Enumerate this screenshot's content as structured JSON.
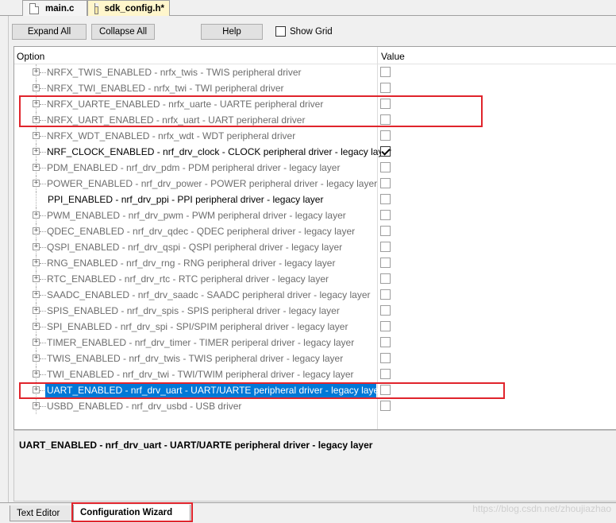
{
  "file_tabs": [
    {
      "label": "main.c",
      "active": false
    },
    {
      "label": "sdk_config.h*",
      "active": true
    }
  ],
  "toolbar": {
    "expand_all": "Expand All",
    "collapse_all": "Collapse All",
    "help": "Help",
    "show_grid": "Show Grid",
    "show_grid_checked": false
  },
  "grid": {
    "col_option": "Option",
    "col_value": "Value",
    "rows": [
      {
        "label": "NRFX_TWIS_ENABLED - nrfx_twis - TWIS peripheral driver",
        "checked": false,
        "enabled": false,
        "expandable": true
      },
      {
        "label": "NRFX_TWI_ENABLED - nrfx_twi - TWI peripheral driver",
        "checked": false,
        "enabled": false,
        "expandable": true
      },
      {
        "label": "NRFX_UARTE_ENABLED - nrfx_uarte - UARTE peripheral driver",
        "checked": false,
        "enabled": false,
        "expandable": true
      },
      {
        "label": "NRFX_UART_ENABLED - nrfx_uart - UART peripheral driver",
        "checked": false,
        "enabled": false,
        "expandable": true
      },
      {
        "label": "NRFX_WDT_ENABLED - nrfx_wdt - WDT peripheral driver",
        "checked": false,
        "enabled": false,
        "expandable": true
      },
      {
        "label": "NRF_CLOCK_ENABLED - nrf_drv_clock - CLOCK peripheral driver - legacy layer",
        "checked": true,
        "enabled": true,
        "expandable": true
      },
      {
        "label": "PDM_ENABLED - nrf_drv_pdm - PDM peripheral driver - legacy layer",
        "checked": false,
        "enabled": false,
        "expandable": true
      },
      {
        "label": "POWER_ENABLED - nrf_drv_power - POWER peripheral driver - legacy layer",
        "checked": false,
        "enabled": false,
        "expandable": true
      },
      {
        "label": "PPI_ENABLED  - nrf_drv_ppi - PPI peripheral driver - legacy layer",
        "checked": false,
        "enabled": true,
        "expandable": false
      },
      {
        "label": "PWM_ENABLED - nrf_drv_pwm - PWM peripheral driver - legacy layer",
        "checked": false,
        "enabled": false,
        "expandable": true
      },
      {
        "label": "QDEC_ENABLED - nrf_drv_qdec - QDEC peripheral driver - legacy layer",
        "checked": false,
        "enabled": false,
        "expandable": true
      },
      {
        "label": "QSPI_ENABLED - nrf_drv_qspi - QSPI peripheral driver - legacy layer",
        "checked": false,
        "enabled": false,
        "expandable": true
      },
      {
        "label": "RNG_ENABLED - nrf_drv_rng - RNG peripheral driver - legacy layer",
        "checked": false,
        "enabled": false,
        "expandable": true
      },
      {
        "label": "RTC_ENABLED - nrf_drv_rtc - RTC peripheral driver - legacy layer",
        "checked": false,
        "enabled": false,
        "expandable": true
      },
      {
        "label": "SAADC_ENABLED - nrf_drv_saadc - SAADC peripheral driver - legacy layer",
        "checked": false,
        "enabled": false,
        "expandable": true
      },
      {
        "label": "SPIS_ENABLED - nrf_drv_spis - SPIS peripheral driver - legacy layer",
        "checked": false,
        "enabled": false,
        "expandable": true
      },
      {
        "label": "SPI_ENABLED - nrf_drv_spi - SPI/SPIM peripheral driver - legacy layer",
        "checked": false,
        "enabled": false,
        "expandable": true
      },
      {
        "label": "TIMER_ENABLED - nrf_drv_timer - TIMER periperal driver - legacy layer",
        "checked": false,
        "enabled": false,
        "expandable": true
      },
      {
        "label": "TWIS_ENABLED - nrf_drv_twis - TWIS peripheral driver - legacy layer",
        "checked": false,
        "enabled": false,
        "expandable": true
      },
      {
        "label": "TWI_ENABLED - nrf_drv_twi - TWI/TWIM peripheral driver - legacy layer",
        "checked": false,
        "enabled": false,
        "expandable": true
      },
      {
        "label": "UART_ENABLED - nrf_drv_uart - UART/UARTE peripheral driver - legacy layer",
        "checked": false,
        "enabled": false,
        "expandable": true,
        "selected": true
      },
      {
        "label": "USBD_ENABLED - nrf_drv_usbd - USB driver",
        "checked": false,
        "enabled": false,
        "expandable": true
      }
    ]
  },
  "description": "UART_ENABLED - nrf_drv_uart - UART/UARTE peripheral driver - legacy layer",
  "bottom_tabs": [
    {
      "label": "Text Editor",
      "active": false
    },
    {
      "label": "Configuration Wizard",
      "active": true
    }
  ],
  "watermark": "https://blog.csdn.net/zhoujiazhao",
  "colors": {
    "selection": "#0078d7",
    "annotation": "#e0242c",
    "active_file_tab": "#fff6cc"
  }
}
